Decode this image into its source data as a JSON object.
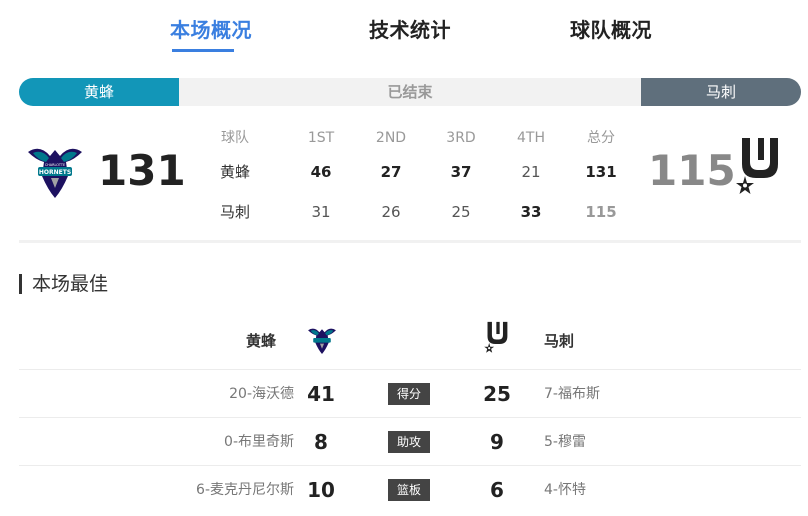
{
  "tabs": [
    {
      "label": "本场概况",
      "active": true
    },
    {
      "label": "技术统计",
      "active": false
    },
    {
      "label": "球队概况",
      "active": false
    }
  ],
  "status": {
    "home_team": "黄蜂",
    "state": "已结束",
    "away_team": "马刺"
  },
  "score": {
    "home": "131",
    "away": "115"
  },
  "quarters": {
    "headers": [
      "球队",
      "1ST",
      "2ND",
      "3RD",
      "4TH",
      "总分"
    ],
    "rows": [
      [
        "黄蜂",
        "46",
        "27",
        "37",
        "21",
        "131"
      ],
      [
        "马刺",
        "31",
        "26",
        "25",
        "33",
        "115"
      ]
    ]
  },
  "best": {
    "title": "本场最佳",
    "home_team": "黄蜂",
    "away_team": "马刺",
    "rows": [
      {
        "home_player": "20-海沃德",
        "home_value": "41",
        "category": "得分",
        "away_value": "25",
        "away_player": "7-福布斯"
      },
      {
        "home_player": "0-布里奇斯",
        "home_value": "8",
        "category": "助攻",
        "away_value": "9",
        "away_player": "5-穆雷"
      },
      {
        "home_player": "6-麦克丹尼尔斯",
        "home_value": "10",
        "category": "篮板",
        "away_value": "6",
        "away_player": "4-怀特"
      }
    ]
  },
  "logos": {
    "home_logo_text": "HORNETS",
    "home_logo_subtext": "CHARLOTTE"
  },
  "colors": {
    "accent": "#3a7fe0",
    "home": "#1296b8",
    "away": "#5f6f7c",
    "hornets_purple": "#1d1160",
    "hornets_teal": "#00788c"
  }
}
